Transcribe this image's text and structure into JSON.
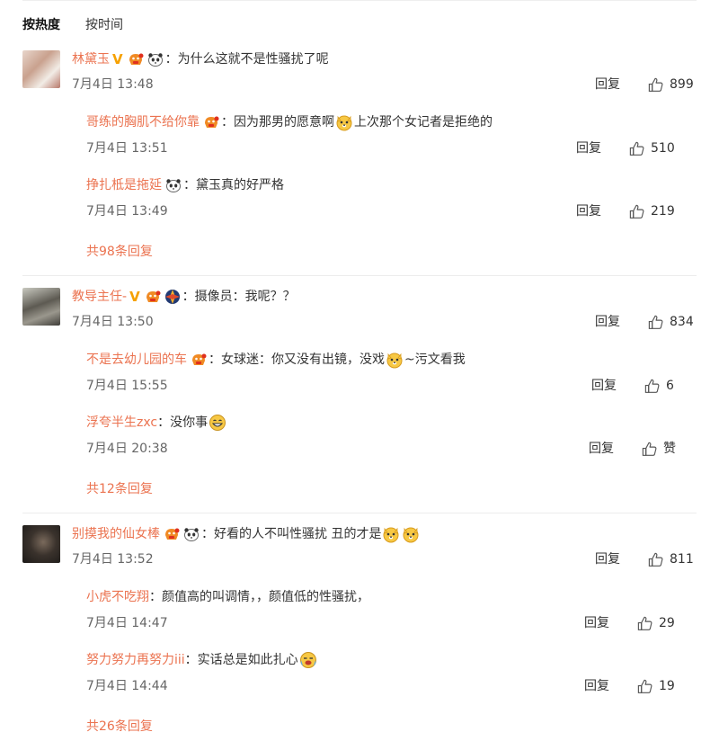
{
  "tabs": [
    "按热度",
    "按时间"
  ],
  "reply_label": "回复",
  "threads": [
    {
      "author": "林黛玉",
      "text": "为什么这就不是性骚扰了呢",
      "time": "7月4日 13:48",
      "likes": "899",
      "replies": [
        {
          "author": "哥练的胸肌不给你靠",
          "text_before": "因为那男的愿意啊",
          "text_after": "上次那个女记者是拒绝的",
          "time": "7月4日 13:51",
          "likes": "510"
        },
        {
          "author": "挣扎柢是拖延",
          "text": "黛玉真的好严格",
          "time": "7月4日 13:49",
          "likes": "219"
        }
      ],
      "more": "共98条回复"
    },
    {
      "author": "教导主任-",
      "text": "摄像员：我呢？？",
      "time": "7月4日 13:50",
      "likes": "834",
      "replies": [
        {
          "author": "不是去幼儿园的车",
          "text_before": "女球迷：你又没有出镜，没戏",
          "text_after": "~污文看我",
          "time": "7月4日 15:55",
          "likes": "6"
        },
        {
          "author": "浮夸半生zxc",
          "text": "没你事",
          "time": "7月4日 20:38",
          "likes": "赞"
        }
      ],
      "more": "共12条回复"
    },
    {
      "author": "别摸我的仙女棒",
      "text": "好看的人不叫性骚扰 丑的才是",
      "time": "7月4日 13:52",
      "likes": "811",
      "replies": [
        {
          "author": "小虎不吃翔",
          "text": "颜值高的叫调情，，颜值低的性骚扰，",
          "time": "7月4日 14:47",
          "likes": "29"
        },
        {
          "author": "努力努力再努力iii",
          "text": "实话总是如此扎心",
          "time": "7月4日 14:44",
          "likes": "19"
        }
      ],
      "more": "共26条回复"
    }
  ],
  "colors": {
    "username": "#eb7350",
    "username_gold": "#d4a243",
    "text": "#333333",
    "time": "#666666"
  }
}
